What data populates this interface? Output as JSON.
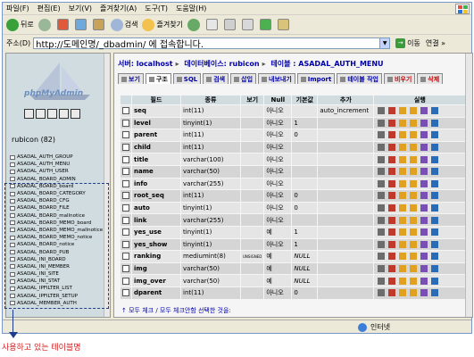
{
  "menu": [
    "파일(F)",
    "편집(E)",
    "보기(V)",
    "즐겨찾기(A)",
    "도구(T)",
    "도움말(H)"
  ],
  "toolbar": {
    "back": "뒤로",
    "search": "검색",
    "favorites": "즐겨찾기"
  },
  "address": {
    "label": "주소(D)",
    "url": "http://도메인명/_dbadmin/ 에 접속합니다.",
    "go": "이동",
    "links": "연결 »"
  },
  "sidebar": {
    "logo": "phpMyAdmin",
    "dbname": "rubicon (82)",
    "tables": [
      "ASADAL_AUTH_GROUP",
      "ASADAL_AUTH_MENU",
      "ASADAL_AUTH_USER",
      "ASADAL_BOARD_ADMIN",
      "ASADAL_BOARD_board",
      "ASADAL_BOARD_CATEGORY",
      "ASADAL_BOARD_CFG",
      "ASADAL_BOARD_FILE",
      "ASADAL_BOARD_mallnotice",
      "ASADAL_BOARD_MEMO_board",
      "ASADAL_BOARD_MEMO_mallnotice",
      "ASADAL_BOARD_MEMO_notice",
      "ASADAL_BOARD_notice",
      "ASADAL_BOARD_PUB",
      "ASADAL_INI_BOARD",
      "ASADAL_INI_MEMBER",
      "ASADAL_INI_SITE",
      "ASADAL_INI_STAT",
      "ASADAL_IPFILTER_LIST",
      "ASADAL_IPFILTER_SETUP",
      "ASADAL_MEMBER_AUTH"
    ]
  },
  "main": {
    "breadcrumb": {
      "server": "서버: localhost",
      "database": "데이터베이스: rubicon",
      "table": "테이블 : ASADAL_AUTH_MENU"
    },
    "tabs": [
      "보기",
      "구조",
      "SQL",
      "검색",
      "삽입",
      "내보내기",
      "Import",
      "테이블 작업",
      "비우기",
      "삭제"
    ],
    "headers": [
      "필드",
      "종류",
      "보기",
      "Null",
      "기본값",
      "추가",
      "실행"
    ],
    "rows": [
      {
        "field": "seq",
        "type": "int(11)",
        "attr": "",
        "null": "아니오",
        "default": "",
        "extra": "auto_increment"
      },
      {
        "field": "level",
        "type": "tinyint(1)",
        "attr": "",
        "null": "아니오",
        "default": "1",
        "extra": ""
      },
      {
        "field": "parent",
        "type": "int(11)",
        "attr": "",
        "null": "아니오",
        "default": "0",
        "extra": ""
      },
      {
        "field": "child",
        "type": "int(11)",
        "attr": "",
        "null": "아니오",
        "default": "",
        "extra": ""
      },
      {
        "field": "title",
        "type": "varchar(100)",
        "attr": "",
        "null": "아니오",
        "default": "",
        "extra": ""
      },
      {
        "field": "name",
        "type": "varchar(50)",
        "attr": "",
        "null": "아니오",
        "default": "",
        "extra": ""
      },
      {
        "field": "info",
        "type": "varchar(255)",
        "attr": "",
        "null": "아니오",
        "default": "",
        "extra": ""
      },
      {
        "field": "root_seq",
        "type": "int(11)",
        "attr": "",
        "null": "아니오",
        "default": "0",
        "extra": ""
      },
      {
        "field": "auto",
        "type": "tinyint(1)",
        "attr": "",
        "null": "아니오",
        "default": "0",
        "extra": ""
      },
      {
        "field": "link",
        "type": "varchar(255)",
        "attr": "",
        "null": "아니오",
        "default": "",
        "extra": ""
      },
      {
        "field": "yes_use",
        "type": "tinyint(1)",
        "attr": "",
        "null": "예",
        "default": "1",
        "extra": ""
      },
      {
        "field": "yes_show",
        "type": "tinyint(1)",
        "attr": "",
        "null": "아니오",
        "default": "1",
        "extra": ""
      },
      {
        "field": "ranking",
        "type": "mediumint(8)",
        "attr": "UNSIGNED",
        "null": "예",
        "default": "NULL",
        "extra": ""
      },
      {
        "field": "img",
        "type": "varchar(50)",
        "attr": "",
        "null": "예",
        "default": "NULL",
        "extra": ""
      },
      {
        "field": "img_over",
        "type": "varchar(50)",
        "attr": "",
        "null": "예",
        "default": "NULL",
        "extra": ""
      },
      {
        "field": "dparent",
        "type": "int(11)",
        "attr": "",
        "null": "아니오",
        "default": "0",
        "extra": ""
      }
    ],
    "footer": "모두 체크 / 모두 체크안함  선택한 것을:"
  },
  "statusbar": {
    "zone": "인터넷"
  },
  "annotation": {
    "label": "사용하고 있는 테이블명"
  }
}
